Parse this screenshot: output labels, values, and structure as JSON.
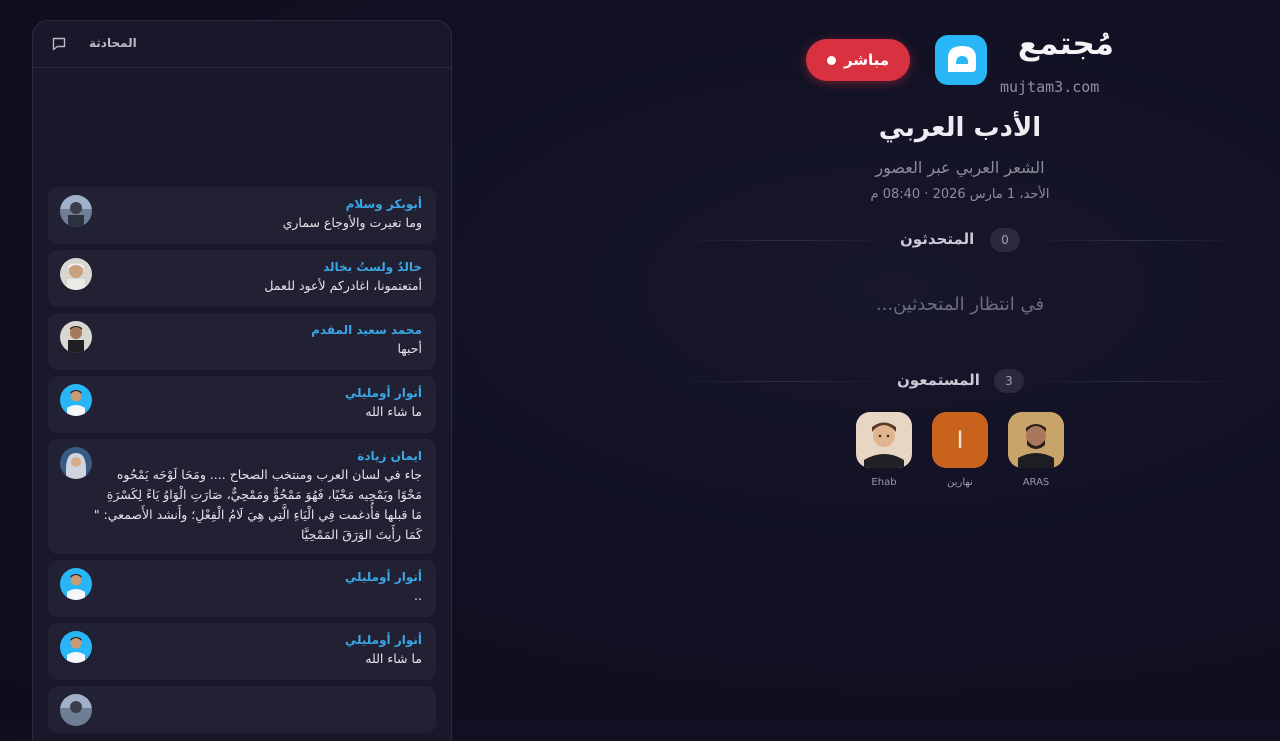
{
  "chat": {
    "title": "المحادثة",
    "messages": [
      {
        "author": "أبوبكر وسلام",
        "lines": [
          "وما تغيرت والأوجاع سماري"
        ]
      },
      {
        "author": "خالدٌ ولستُ بخالد",
        "lines": [
          "أمتعتمونا، اغادركم لأعود للعمل"
        ]
      },
      {
        "author": "محمد سعيد المقدم",
        "lines": [
          "أحبها"
        ]
      },
      {
        "author": "أنوار أومليلي",
        "lines": [
          "ما شاء الله"
        ]
      },
      {
        "author": "ايمان زيادة",
        "lines": [
          "جاء في لسان العرب ومنتخب الصحاح .... ومَحَا لَوْحَه يَمْحُوه",
          "مَحْوًا ويَمْحِيه مَحْيًا، فَهُوَ مَمْحُوٌّ ومَمْحِيٌّ، صَارَتِ الْوَاوُ يَاءً لِكَسْرَةِ",
          "مَا قبلها فأُدغمت فِي الْيَاءِ الَّتِي هِيَ لَامُ الْفِعْلِ؛ وأَنشد الأَصمعي: \"",
          "كَمَا رأَيتَ الوَرَقَ المَمْحِيَّا"
        ]
      },
      {
        "author": "أنوار أومليلي",
        "lines": [
          ".."
        ]
      },
      {
        "author": "أنوار أومليلي",
        "lines": [
          "ما شاء الله"
        ]
      }
    ]
  },
  "header": {
    "live_label": "مباشر",
    "logo_text": "مُجتمع",
    "logo_url": "mujtam3.com"
  },
  "room": {
    "title": "الأدب العربي",
    "subtitle": "الشعر العربي عبر العصور",
    "datetime": "الأحد، 1 مارس 2026 · 08:40 م"
  },
  "speakers": {
    "title": "المتحدثون",
    "count": "0",
    "empty_text": "...في انتظار المتحدثين"
  },
  "listeners": {
    "title": "المستمعون",
    "count": "3",
    "people": [
      {
        "name": "ARAS"
      },
      {
        "name": "نهارين",
        "initial": "I"
      },
      {
        "name": "Ehab"
      }
    ]
  },
  "colors": {
    "accent_live": "#d8313f",
    "name_blue": "#3aa6e6",
    "logo_cyan": "#29b6f6",
    "orange_avatar": "#c8621c"
  }
}
